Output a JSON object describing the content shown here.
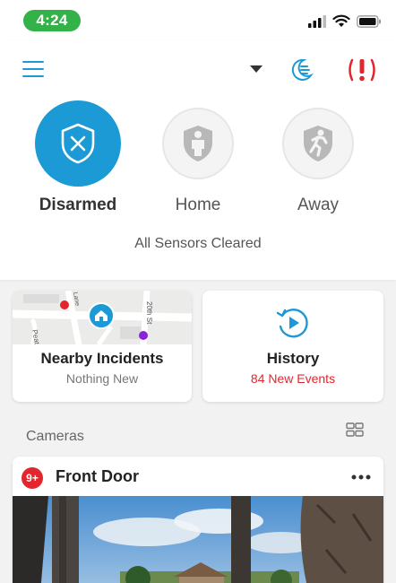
{
  "status_bar": {
    "time": "4:24"
  },
  "header": {
    "modes": [
      {
        "label": "Disarmed",
        "active": true,
        "icon": "shield-x-icon"
      },
      {
        "label": "Home",
        "active": false,
        "icon": "shield-person-icon"
      },
      {
        "label": "Away",
        "active": false,
        "icon": "shield-running-icon"
      }
    ],
    "sensor_status": "All Sensors Cleared"
  },
  "nearby": {
    "street_labels": [
      "20th St",
      "Peat",
      "Lane"
    ],
    "title": "Nearby Incidents",
    "subtitle": "Nothing New"
  },
  "history": {
    "title": "History",
    "subtitle": "84 New Events"
  },
  "cameras": {
    "label": "Cameras",
    "items": [
      {
        "badge": "9+",
        "name": "Front Door"
      }
    ]
  },
  "colors": {
    "accent": "#1b9ad6",
    "alert": "#e3262e",
    "status_green": "#34b24a"
  }
}
